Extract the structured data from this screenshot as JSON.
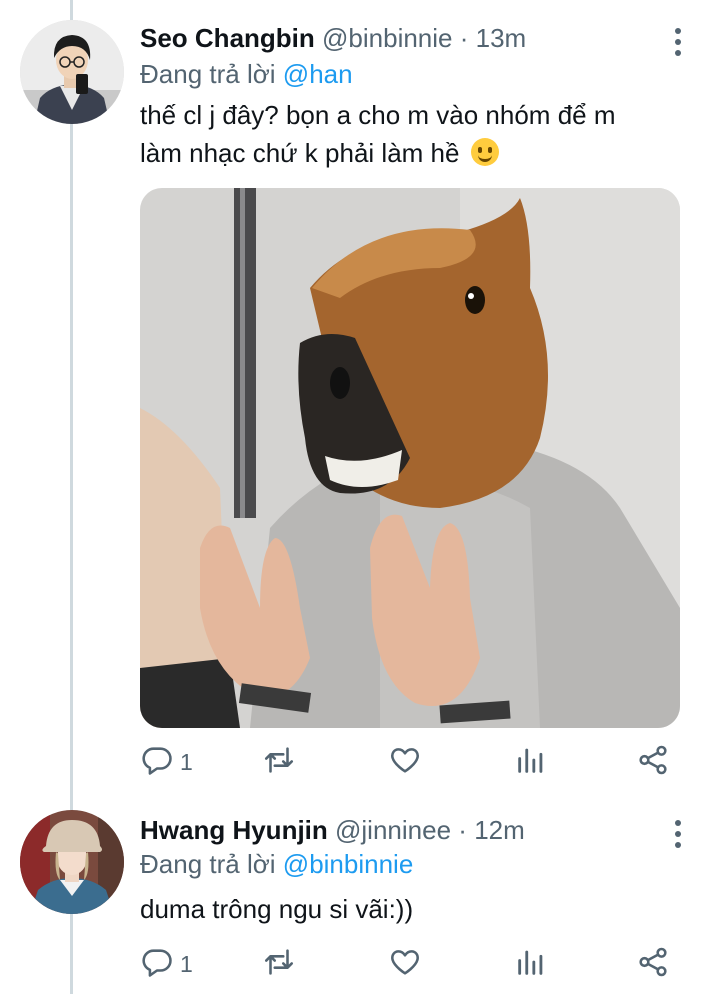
{
  "tweets": [
    {
      "name": "Seo Changbin",
      "handle": "@binbinnie",
      "separator": "·",
      "time": "13m",
      "replying_prefix": "Đang trả lời",
      "replying_to": "@han",
      "text_line1": "thế cl j đây? bọn a cho m vào nhóm để m",
      "text_line2": "làm nhạc chứ k phải làm hề",
      "emoji": "slightly-smiling-face",
      "reply_count": "1"
    },
    {
      "name": "Hwang Hyunjin",
      "handle": "@jinninee",
      "separator": "·",
      "time": "12m",
      "replying_prefix": "Đang trả lời",
      "replying_to": "@binbinnie",
      "text": "duma trông ngu si vãi:))",
      "reply_count": "1"
    }
  ],
  "icons": [
    "reply-icon",
    "retweet-icon",
    "like-icon",
    "analytics-icon",
    "share-icon",
    "more-icon"
  ],
  "colors": {
    "accent": "#1d9bf0",
    "secondary_text": "#536471",
    "thread_line": "#cfd9de"
  }
}
